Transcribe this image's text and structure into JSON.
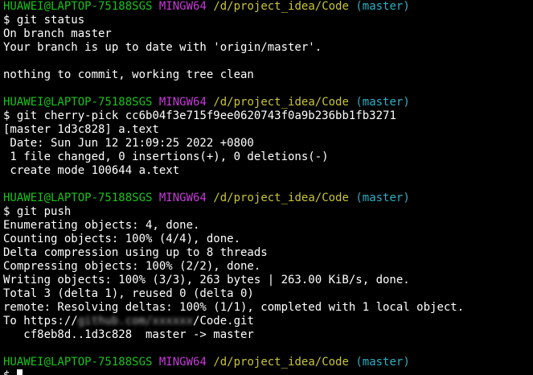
{
  "prompt": {
    "user_host": "HUAWEI@LAPTOP-75188SGS",
    "env": "MINGW64",
    "path": "/d/project_idea/Code",
    "branch": "(master)",
    "symbol": "$"
  },
  "blocks": {
    "status": {
      "command": "git status",
      "output": [
        "On branch master",
        "Your branch is up to date with 'origin/master'.",
        "",
        "nothing to commit, working tree clean"
      ]
    },
    "cherry_pick": {
      "command": "git cherry-pick cc6b04f3e715f9ee0620743f0a9b236bb1fb3271",
      "output": [
        "[master 1d3c828] a.text",
        " Date: Sun Jun 12 21:09:25 2022 +0800",
        " 1 file changed, 0 insertions(+), 0 deletions(-)",
        " create mode 100644 a.text"
      ]
    },
    "push": {
      "command": "git push",
      "output": [
        "Enumerating objects: 4, done.",
        "Counting objects: 100% (4/4), done.",
        "Delta compression using up to 8 threads",
        "Compressing objects: 100% (2/2), done.",
        "Writing objects: 100% (3/3), 263 bytes | 263.00 KiB/s, done.",
        "Total 3 (delta 1), reused 0 (delta 0)",
        "remote: Resolving deltas: 100% (1/1), completed with 1 local object."
      ],
      "to_prefix": "To https://",
      "to_blurred": "github.com/xxxxxx",
      "to_suffix": "/Code.git",
      "ref_update": "   cf8eb8d..1d3c828  master -> master"
    }
  },
  "colors": {
    "background": "#000000",
    "user_host": "#18c41a",
    "env": "#c63ad8",
    "path": "#c9c436",
    "branch": "#2ab0c6",
    "text": "#ffffff"
  }
}
